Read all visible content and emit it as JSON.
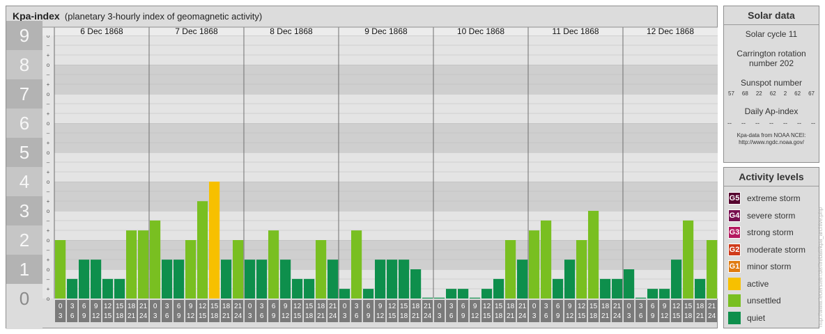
{
  "title": "Kpa-index",
  "subtitle": "(planetary 3-hourly index of geomagnetic activity)",
  "chart_data": {
    "type": "bar",
    "title": "Kpa-index",
    "subtitle": "(planetary 3-hourly index of geomagnetic activity)",
    "ylim": [
      0,
      9
    ],
    "y_ticks": [
      "0",
      "1",
      "2",
      "3",
      "4",
      "5",
      "6",
      "7",
      "8",
      "9"
    ],
    "minor_ticks": [
      "o",
      "+",
      "–"
    ],
    "days": [
      "6 Dec 1868",
      "7 Dec 1868",
      "8 Dec 1868",
      "9 Dec 1868",
      "10 Dec 1868",
      "11 Dec 1868",
      "12 Dec 1868"
    ],
    "hour_starts": [
      "0",
      "3",
      "6",
      "9",
      "12",
      "15",
      "18",
      "21"
    ],
    "hour_ends": [
      "3",
      "6",
      "9",
      "12",
      "15",
      "18",
      "21",
      "24"
    ],
    "values": [
      2.0,
      0.67,
      1.33,
      1.33,
      0.67,
      0.67,
      2.33,
      2.33,
      2.67,
      1.33,
      1.33,
      2.0,
      3.33,
      4.0,
      1.33,
      2.0,
      1.33,
      1.33,
      2.33,
      1.33,
      0.67,
      0.67,
      2.0,
      1.33,
      0.33,
      2.33,
      0.33,
      1.33,
      1.33,
      1.33,
      1.0,
      0.0,
      0.0,
      0.33,
      0.33,
      0.0,
      0.33,
      0.67,
      2.0,
      1.33,
      2.33,
      2.67,
      0.67,
      1.33,
      2.0,
      3.0,
      0.67,
      0.67,
      1.0,
      0.0,
      0.33,
      0.33,
      1.33,
      2.67,
      0.67,
      2.0
    ],
    "level_colors": {
      "quiet": "#0e8f4c",
      "unsettled": "#79bf21",
      "active": "#f7c000",
      "minor": "#e07b10",
      "moderate": "#cf3a1a",
      "strong": "#b4185f",
      "severe": "#760d4f",
      "extreme": "#55022e"
    }
  },
  "solar": {
    "title": "Solar data",
    "cycle": "Solar cycle 11",
    "carrington": "Carrington rotation number 202",
    "sunspot_label": "Sunspot number",
    "sunspots": [
      "57",
      "68",
      "22",
      "62",
      "2",
      "62",
      "67"
    ],
    "ap_label": "Daily Ap-index",
    "ap": [
      "--",
      "--",
      "--",
      "--",
      "--",
      "--",
      "--"
    ],
    "credit1": "Kpa-data from NOAA NCEI:",
    "credit2": "http://www.ngdc.noaa.gov/"
  },
  "levels": {
    "title": "Activity levels",
    "items": [
      {
        "code": "G5",
        "label": "extreme storm",
        "color": "#55022e"
      },
      {
        "code": "G4",
        "label": "severe storm",
        "color": "#760d4f"
      },
      {
        "code": "G3",
        "label": "strong storm",
        "color": "#b4185f"
      },
      {
        "code": "G2",
        "label": "moderate storm",
        "color": "#cf3a1a"
      },
      {
        "code": "G1",
        "label": "minor storm",
        "color": "#e07b10"
      },
      {
        "code": "",
        "label": "active",
        "color": "#f7c000"
      },
      {
        "code": "",
        "label": "unsettled",
        "color": "#79bf21"
      },
      {
        "code": "",
        "label": "quiet",
        "color": "#0e8f4c"
      }
    ]
  },
  "credit_vertical": "http://www.feuerstein.de/fireball/kpa_archive.php"
}
